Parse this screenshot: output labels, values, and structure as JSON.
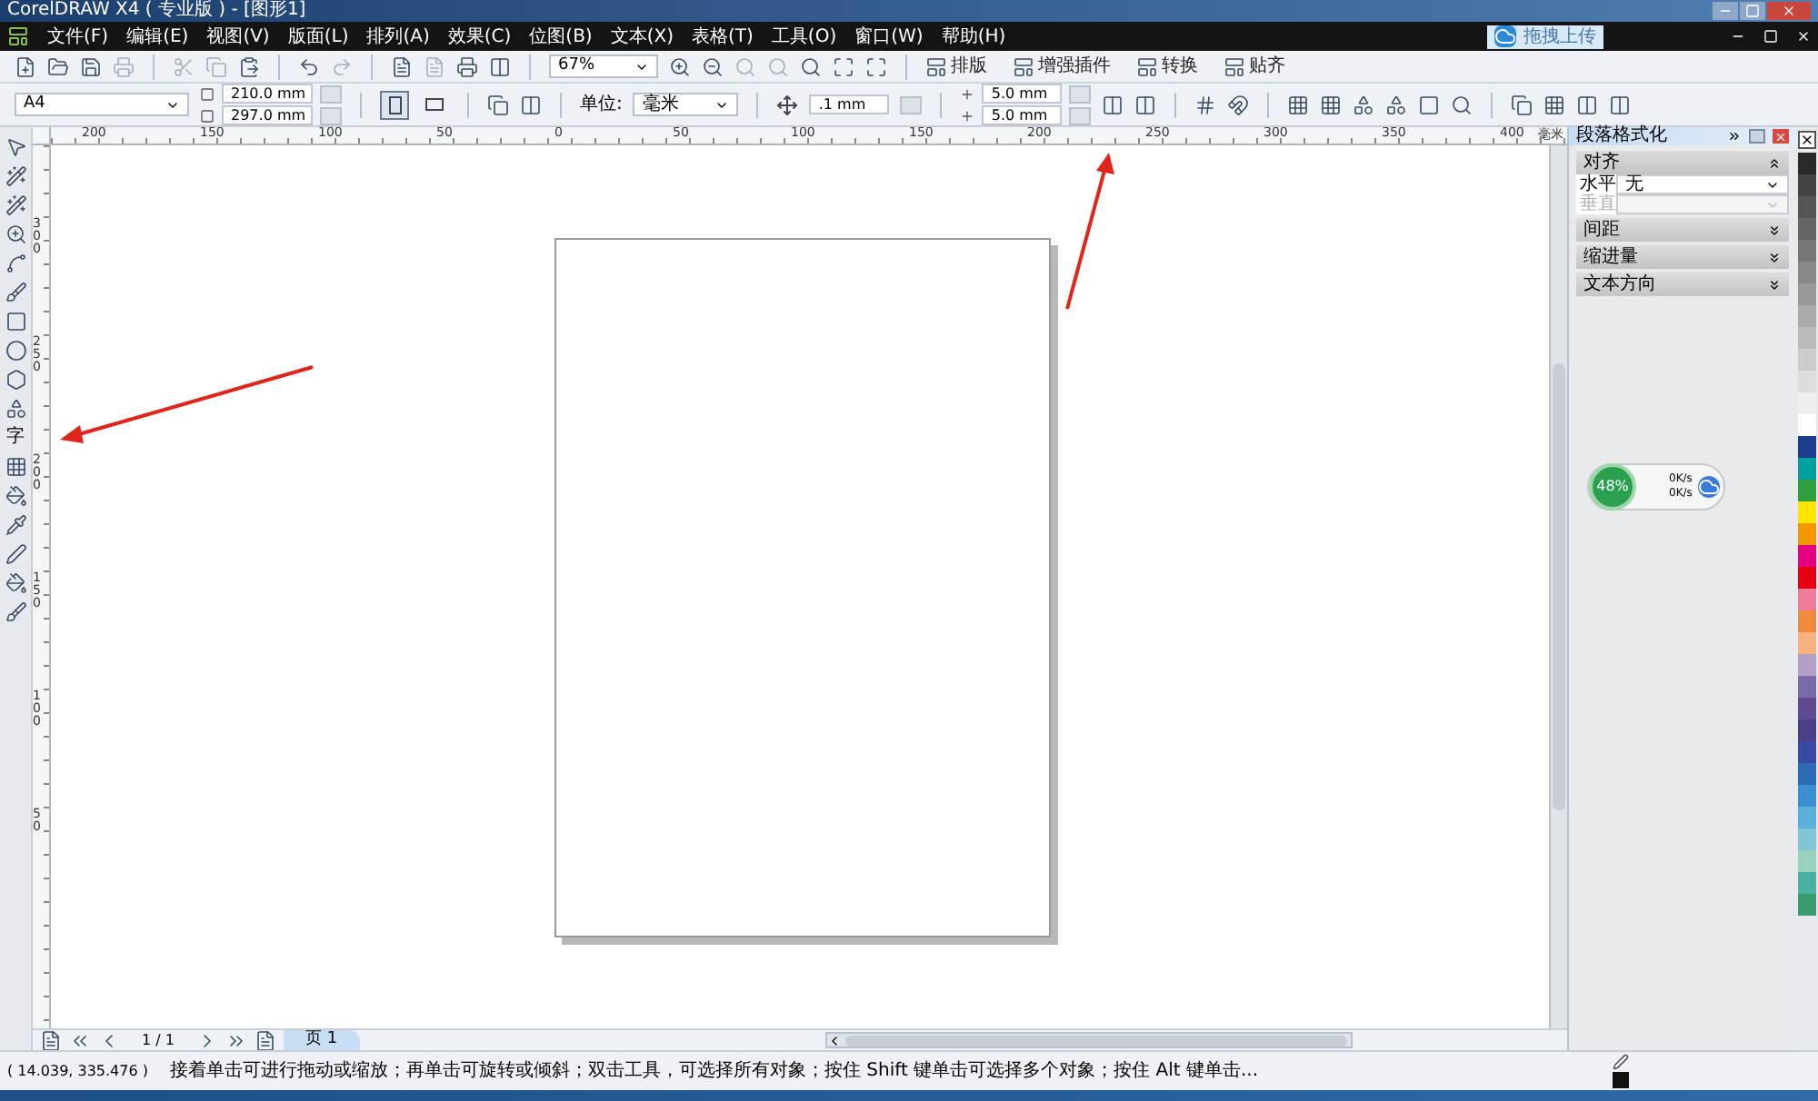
{
  "window": {
    "title": "CorelDRAW X4 ( 专业版 ) - [图形1]"
  },
  "menu": [
    "文件(F)",
    "编辑(E)",
    "视图(V)",
    "版面(L)",
    "排列(A)",
    "效果(C)",
    "位图(B)",
    "文本(X)",
    "表格(T)",
    "工具(O)",
    "窗口(W)",
    "帮助(H)"
  ],
  "upload_button": {
    "label": "拖拽上传"
  },
  "toolbar": {
    "zoom": "67%",
    "buttons": [
      "排版",
      "增强插件",
      "转换",
      "贴齐"
    ]
  },
  "property_bar": {
    "paper": "A4",
    "width": "210.0 mm",
    "height": "297.0 mm",
    "unit_label": "单位:",
    "unit": "毫米",
    "nudge": ".1 mm",
    "dup_x": "5.0 mm",
    "dup_y": "5.0 mm",
    "orientation": [
      {
        "kind": "portrait",
        "selected": true
      },
      {
        "kind": "landscape",
        "selected": false
      }
    ]
  },
  "toolbox": {
    "text_tool": "字"
  },
  "rulers": {
    "unit": "毫米",
    "horizontal": [
      "200",
      "150",
      "100",
      "50",
      "0",
      "50",
      "100",
      "150",
      "200",
      "250",
      "300",
      "350",
      "400"
    ],
    "vertical": [
      "300",
      "250",
      "200",
      "150",
      "100",
      "50"
    ]
  },
  "docker": {
    "title": "段落格式化",
    "sections": [
      {
        "label": "对齐",
        "expanded": true,
        "fields": [
          {
            "label": "水平",
            "value": "无",
            "disabled": false
          },
          {
            "label": "垂直",
            "disabled": true
          }
        ]
      },
      {
        "label": "间距",
        "expanded": false
      },
      {
        "label": "缩进量",
        "expanded": false
      },
      {
        "label": "文本方向",
        "expanded": false
      }
    ]
  },
  "network_widget": {
    "percent": "48%",
    "upload": "0K/s",
    "download": "0K/s"
  },
  "page_nav": {
    "counter": "1 / 1",
    "tabs": [
      {
        "label": "页 1",
        "selected": true
      }
    ]
  },
  "status_bar": {
    "coordinates": "( 14.039, 335.476 )",
    "hint": "接着单击可进行拖动或缩放；再单击可旋转或倾斜；双击工具，可选择所有对象；按住 Shift 键单击可选择多个对象；按住 Alt 键单击..."
  },
  "palette": [
    {
      "color": "#2a2a2a"
    },
    {
      "color": "#444444"
    },
    {
      "color": "#555555"
    },
    {
      "color": "#666666"
    },
    {
      "color": "#777777"
    },
    {
      "color": "#888888"
    },
    {
      "color": "#999999"
    },
    {
      "color": "#aaaaaa"
    },
    {
      "color": "#bbbbbb"
    },
    {
      "color": "#cccccc"
    },
    {
      "color": "#dddddd"
    },
    {
      "color": "#eeeeee"
    },
    {
      "color": "#ffffff"
    },
    {
      "color": "#1a3e8c"
    },
    {
      "color": "#00a0a0"
    },
    {
      "color": "#2e9e3e"
    },
    {
      "color": "#ffe600"
    },
    {
      "color": "#f39800"
    },
    {
      "color": "#e4007f"
    },
    {
      "color": "#e60012"
    },
    {
      "color": "#ee7c9b"
    },
    {
      "color": "#f08a3c"
    },
    {
      "color": "#f6b37f"
    },
    {
      "color": "#b0a0c8"
    },
    {
      "color": "#7b6aa8"
    },
    {
      "color": "#5e4a8e"
    },
    {
      "color": "#4b3f87"
    },
    {
      "color": "#3a4aa0"
    },
    {
      "color": "#2e6bb5"
    },
    {
      "color": "#3b8fd0"
    },
    {
      "color": "#5ab0d8"
    },
    {
      "color": "#7fc5d6"
    },
    {
      "color": "#9ad0c0"
    },
    {
      "color": "#4ab0a0"
    },
    {
      "color": "#3a9a70"
    }
  ]
}
